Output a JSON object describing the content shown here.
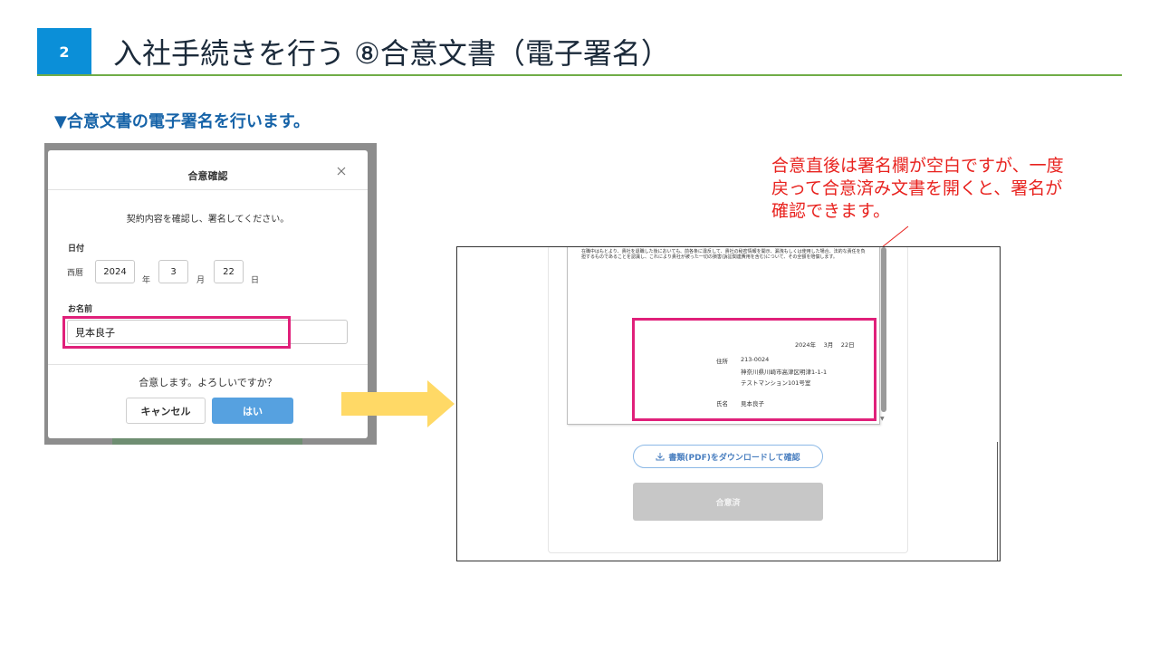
{
  "slide": {
    "step_number": "2",
    "title": "入社手続きを行う ⑧合意文書（電子署名）",
    "section_heading": "▼合意文書の電子署名を行います。"
  },
  "dialog": {
    "title": "合意確認",
    "close_glyph": "×",
    "message": "契約内容を確認し、署名してください。",
    "date_label": "日付",
    "era_label": "西暦",
    "year_value": "2024",
    "year_unit": "年",
    "month_value": "3",
    "month_unit": "月",
    "day_value": "22",
    "day_unit": "日",
    "name_label": "お名前",
    "name_value": "見本良子",
    "confirm_text": "合意します。よろしいですか？",
    "cancel_label": "キャンセル",
    "yes_label": "はい"
  },
  "callout": {
    "text": "合意直後は署名欄が空白ですが、一度戻って合意済み文書を開くと、署名が確認できます。"
  },
  "document": {
    "body_text": "在職中はもとより、貴社を退職した後においても、前各条に違反して、貴社の秘密情報を開示、漏洩もしくは使用した場合、法的な責任を負担するものであることを認識し、これにより貴社が被った一切の損害(訴訟関連費用を含む)について、その全額を賠償します。",
    "signature_date": "2024年　 3月　 22日",
    "address_label": "住所",
    "postal_code": "213-0024",
    "address_line1": "神奈川県川崎市高津区明津1-1-1",
    "address_line2": "テストマンション101号室",
    "name_label": "氏名",
    "name_value": "見本良子",
    "download_label": "書類(PDF)をダウンロードして確認",
    "agreed_label": "合意済"
  },
  "colors": {
    "badge": "#0b8fd8",
    "title_rule": "#70ad47",
    "heading": "#1663a8",
    "highlight": "#e0207a",
    "callout": "#e8231f",
    "arrow": "#ffd966",
    "primary_button": "#56a1e0"
  },
  "icons": {
    "close": "close-icon",
    "download": "download-icon",
    "arrow": "right-arrow-icon"
  }
}
